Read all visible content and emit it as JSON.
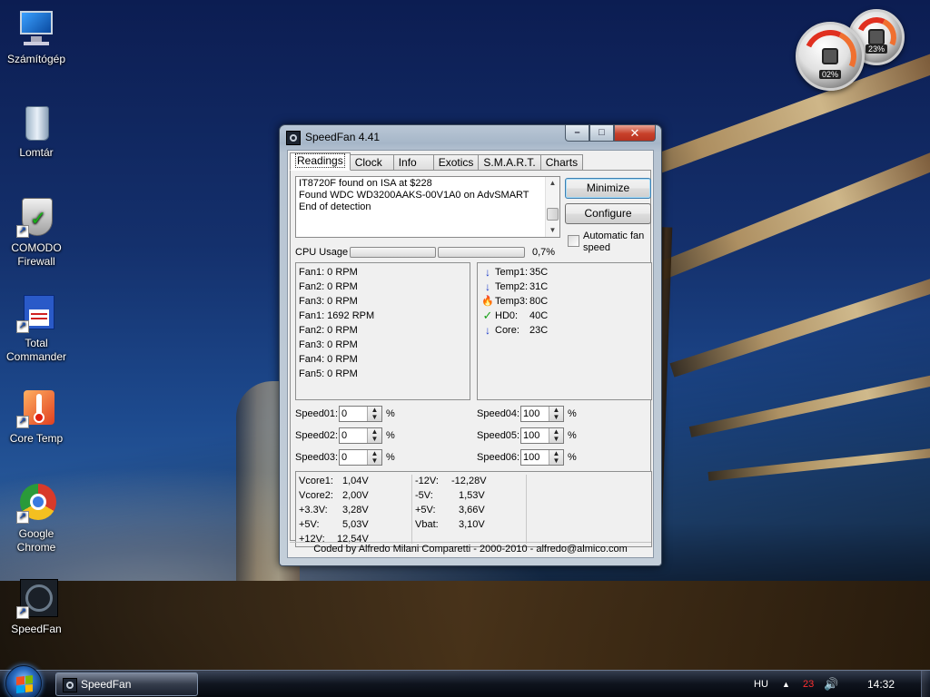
{
  "desktop": {
    "icons": [
      {
        "label": "Számítógép",
        "icon": "computer-icon"
      },
      {
        "label": "Lomtár",
        "icon": "recycle-bin-icon"
      },
      {
        "label": "COMODO Firewall",
        "icon": "shield-icon"
      },
      {
        "label": "Total Commander",
        "icon": "floppy-icon"
      },
      {
        "label": "Core Temp",
        "icon": "thermometer-icon"
      },
      {
        "label": "Google Chrome",
        "icon": "chrome-icon"
      },
      {
        "label": "SpeedFan",
        "icon": "fan-icon"
      }
    ],
    "gadget": {
      "cpu_pct": "02%",
      "ram_pct": "23%"
    }
  },
  "window": {
    "title": "SpeedFan 4.41",
    "tabs": [
      "Readings",
      "Clock",
      "Info",
      "Exotics",
      "S.M.A.R.T.",
      "Charts"
    ],
    "active_tab": "Readings",
    "log_lines": [
      "IT8720F found on ISA at $228",
      "Found WDC WD3200AAKS-00V1A0 on AdvSMART",
      "End of detection"
    ],
    "buttons": {
      "minimize": "Minimize",
      "configure": "Configure"
    },
    "auto_fan_label": "Automatic fan speed",
    "auto_fan_checked": false,
    "cpu_usage": {
      "label": "CPU Usage",
      "value": "0,7%",
      "bar1_fraction": 0.0,
      "bar2_fraction": 0.0
    },
    "fans": [
      "Fan1: 0 RPM",
      "Fan2: 0 RPM",
      "Fan3: 0 RPM",
      "Fan1: 1692 RPM",
      "Fan2: 0 RPM",
      "Fan3: 0 RPM",
      "Fan4: 0 RPM",
      "Fan5: 0 RPM"
    ],
    "temps": [
      {
        "name": "Temp1:",
        "value": "35C",
        "icon": "arrow-down-icon"
      },
      {
        "name": "Temp2:",
        "value": "31C",
        "icon": "arrow-down-icon"
      },
      {
        "name": "Temp3:",
        "value": "80C",
        "icon": "fire-icon"
      },
      {
        "name": "HD0:",
        "value": "40C",
        "icon": "checkmark-icon"
      },
      {
        "name": "Core:",
        "value": "23C",
        "icon": "arrow-down-icon"
      }
    ],
    "speeds": [
      {
        "label": "Speed01:",
        "value": "0"
      },
      {
        "label": "Speed02:",
        "value": "0"
      },
      {
        "label": "Speed03:",
        "value": "0"
      },
      {
        "label": "Speed04:",
        "value": "100"
      },
      {
        "label": "Speed05:",
        "value": "100"
      },
      {
        "label": "Speed06:",
        "value": "100"
      }
    ],
    "percent_symbol": "%",
    "voltages_left": [
      {
        "name": "Vcore1:",
        "value": "1,04V"
      },
      {
        "name": "Vcore2:",
        "value": "2,00V"
      },
      {
        "name": "+3.3V:",
        "value": "3,28V"
      },
      {
        "name": "+5V:",
        "value": "5,03V"
      },
      {
        "name": "+12V:",
        "value": "12,54V"
      }
    ],
    "voltages_right": [
      {
        "name": "-12V:",
        "value": "-12,28V"
      },
      {
        "name": "-5V:",
        "value": "1,53V"
      },
      {
        "name": "+5V:",
        "value": "3,66V"
      },
      {
        "name": "Vbat:",
        "value": "3,10V"
      }
    ],
    "status": "Coded by Alfredo Milani Comparetti - 2000-2010 - alfredo@almico.com"
  },
  "taskbar": {
    "task_label": "SpeedFan",
    "lang": "HU",
    "tray_temp": "23",
    "clock": "14:32"
  },
  "colors": {
    "accent": "#44c444",
    "close_button": "#c7402a",
    "tray_temp": "#ff3030"
  }
}
